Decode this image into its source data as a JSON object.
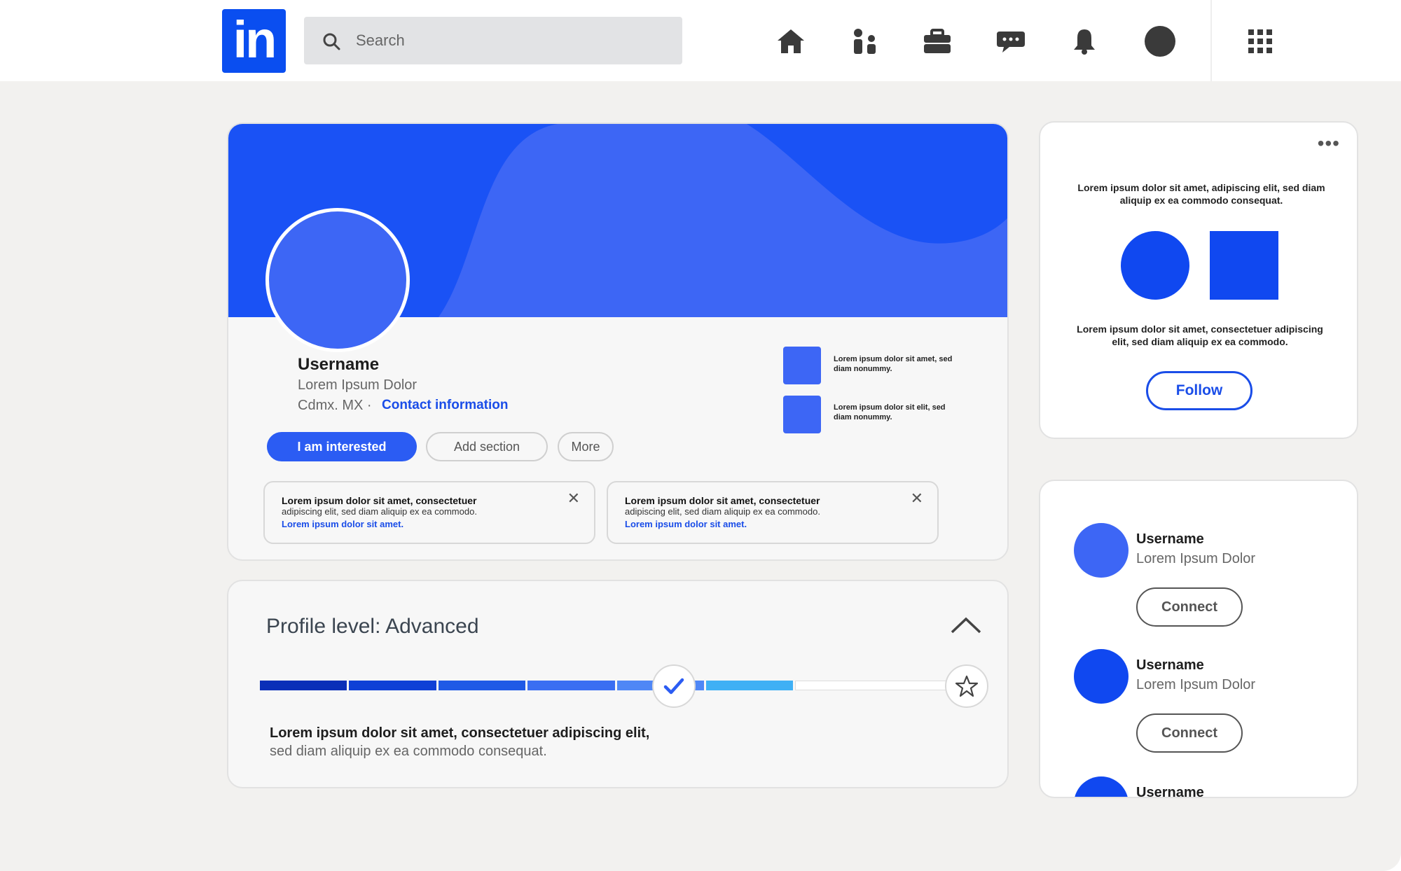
{
  "nav": {
    "logo_text": "in",
    "search_placeholder": "Search",
    "icons": [
      "home-icon",
      "network-icon",
      "jobs-icon",
      "messaging-icon",
      "notifications-icon",
      "me-avatar",
      "apps-grid-icon"
    ]
  },
  "colors": {
    "brand": "#0a4ef0",
    "banner_dark": "#1a52f5",
    "banner_light": "#3d66f5",
    "link": "#1a4de8"
  },
  "profile": {
    "name": "Username",
    "headline": "Lorem Ipsum Dolor",
    "location": "Cdmx. MX ·",
    "contact_link": "Contact information",
    "buttons": {
      "interested": "I am interested",
      "add_section": "Add section",
      "more": "More"
    },
    "side_items": [
      {
        "text": "Lorem ipsum dolor sit amet, sed diam nonummy."
      },
      {
        "text": "Lorem ipsum dolor sit elit, sed diam nonummy."
      }
    ],
    "notices": [
      {
        "title": "Lorem ipsum dolor sit amet, consectetuer",
        "body": "adipiscing elit, sed diam aliquip ex ea commodo.",
        "link": "Lorem ipsum dolor sit amet.",
        "close": "✕"
      },
      {
        "title": "Lorem ipsum dolor sit amet, consectetuer",
        "body": "adipiscing elit, sed diam aliquip ex ea commodo.",
        "link": "Lorem ipsum dolor sit amet.",
        "close": "✕"
      }
    ]
  },
  "level": {
    "title": "Profile level: Advanced",
    "line1": "Lorem ipsum dolor sit amet, consectetuer adipiscing elit,",
    "line2": "sed diam aliquip ex ea commodo consequat.",
    "segment_colors": [
      "#0a2fb8",
      "#0f40d6",
      "#1f5ae6",
      "#3a6ef2",
      "#4f87f6",
      "#3fb0f5"
    ],
    "progress": 0.78
  },
  "follow_card": {
    "dots": "•••",
    "text1": "Lorem ipsum dolor sit amet, adipiscing elit, sed diam aliquip ex ea commodo consequat.",
    "text2": "Lorem ipsum dolor sit amet, consectetuer adipiscing elit, sed diam aliquip ex ea commodo.",
    "follow_label": "Follow"
  },
  "people": [
    {
      "name": "Username",
      "headline": "Lorem Ipsum Dolor",
      "connect": "Connect",
      "color": "#3d66f5"
    },
    {
      "name": "Username",
      "headline": "Lorem Ipsum Dolor",
      "connect": "Connect",
      "color": "#1048f0"
    },
    {
      "name": "Username",
      "headline": "",
      "connect": "",
      "color": "#1048f0"
    }
  ]
}
